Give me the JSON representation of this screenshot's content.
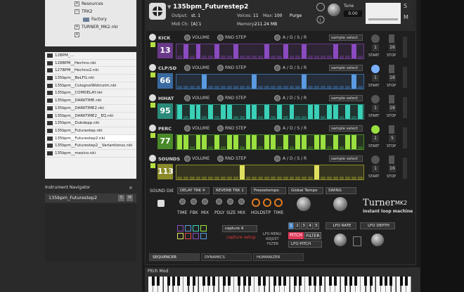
{
  "browser": {
    "tree": [
      {
        "label": "Resources",
        "type": "plus"
      },
      {
        "label": "TRK2",
        "type": "minus"
      },
      {
        "label": "Factory",
        "type": "folder"
      },
      {
        "label": "TURNER_MK2.nkr",
        "type": "plus"
      },
      {
        "label": "",
        "type": "plus"
      }
    ],
    "files": [
      "12BPM_...",
      "128BPM__Hechno.nki",
      "127BPM__Hechno2.nki",
      "135bpm__BeLFG.nki",
      "135bpm__ColognelWohnzim.nki",
      "135bpm__COMDELAY.nki",
      "135bpm__DARKTIME.nki",
      "135bpm__DARKTIME2.nki",
      "135bpm__DARKTIME2__EQ.nki",
      "135bpm__Dubdepp.nki",
      "135bpm__Futurestep.nki",
      "135bpm__Futurestep2.nki",
      "135bpm__Futurestep2__Variantionsc.nki",
      "135bpm__mexico.nki"
    ],
    "selected_index": 11
  },
  "navigator": {
    "title": "Instrument Navigator",
    "close": "×",
    "item": "135bpm_Futurestep2",
    "btn1": "S",
    "btn2": "M"
  },
  "header": {
    "title": "135bpm_Futurestep2",
    "output_label": "Output:",
    "output_value": "st. 1",
    "voices_label": "Voices:",
    "voices_value": "11",
    "max_label": "Max:",
    "max_value": "100",
    "purge_label": "Purge",
    "midi_label": "Midi Ch:",
    "midi_value": "[A]  1",
    "memory_label": "Memory:",
    "memory_value": "211.24 MB",
    "tune_label": "Tune",
    "tune_value": "0.00"
  },
  "common": {
    "volume": "VOLUME",
    "rnd_step": "RND STEP",
    "adsr": "A / D / S / R",
    "sample_select": "sample select",
    "start": "START",
    "stop": "STOP"
  },
  "tracks": [
    {
      "name": "KICK",
      "value": "13",
      "color": "#6a3a8a",
      "bar_color": "#8a4ac0",
      "bars": [
        0,
        1,
        0,
        1,
        0,
        0,
        1,
        0,
        0,
        1,
        0,
        0,
        0,
        0,
        1,
        0,
        0,
        1,
        0,
        0,
        1,
        0,
        0,
        0,
        0,
        1,
        0,
        0,
        1,
        0
      ],
      "start": "1",
      "stop": "16"
    },
    {
      "name": "CLP/SD",
      "value": "66",
      "color": "#3a6aa0",
      "bar_color": "#5a9ae0",
      "bars": [
        0,
        0,
        0,
        0,
        1,
        0,
        0,
        0,
        0,
        0,
        0,
        0,
        1,
        0,
        0,
        0,
        0,
        0,
        0,
        0,
        1,
        0,
        0,
        0,
        0,
        0,
        0,
        0,
        1,
        0
      ],
      "start": "1",
      "stop": "16"
    },
    {
      "name": "HIHAT",
      "value": "95",
      "color": "#2a8a7a",
      "bar_color": "#3ad0b8",
      "bars": [
        1,
        0,
        1,
        1,
        0,
        1,
        0,
        1,
        1,
        0,
        0,
        1,
        1,
        0,
        1,
        0,
        1,
        0,
        1,
        0,
        0,
        1,
        1,
        0,
        1,
        1,
        0,
        1,
        0,
        1
      ],
      "start": "1",
      "stop": "16"
    },
    {
      "name": "PERC",
      "value": "77",
      "color": "#4a8a2a",
      "bar_color": "#9ae040",
      "bars": [
        1,
        1,
        0,
        1,
        1,
        0,
        1,
        0,
        1,
        1,
        0,
        1,
        1,
        0,
        1,
        1,
        0,
        1,
        0,
        1,
        1,
        0,
        1,
        1,
        0,
        1,
        0,
        1,
        1,
        0
      ],
      "start": "1",
      "stop": "5"
    },
    {
      "name": "SOUNDS",
      "value": "113",
      "color": "#8a8a2a",
      "bar_color": "#e0e060",
      "bars": [
        0,
        0,
        0,
        0,
        0,
        0,
        0,
        0,
        0,
        0,
        1,
        0,
        0,
        0,
        0,
        0,
        0,
        0,
        0,
        0,
        0,
        0,
        1,
        0,
        0,
        0,
        0,
        0,
        0,
        0
      ],
      "start": "1",
      "stop": "16"
    }
  ],
  "fx": {
    "sound_die": "SOUND DIE",
    "delay_trk": "DELAY TRK 4",
    "reverb_trk": "REVERB TRK 1",
    "freeze": "Freezetempo",
    "global_temp": "Global Tempo",
    "swing": "SWING",
    "time": "TIME",
    "fbk": "FBK",
    "mix1": "MIX",
    "pdly": "PDLY",
    "size": "SIZE",
    "mix2": "MIX",
    "hold": "HOLD",
    "stp": "STP",
    "time2": "TIME",
    "turner": "Turner",
    "mk2": "MK2",
    "tagline": "instant loop machine",
    "capture_value": "capture 4",
    "capture_setup": "capture setup",
    "lfo_menu": "LFO MENU",
    "adjust": "ADJUST",
    "filter_lbl": "FILTER",
    "pitch": "PITCH",
    "filter": "FILTER",
    "lfo_pitch": "LFO PITCH",
    "lfo_rate": "LFO RATE",
    "lfo_depth": "LFO DEPTH",
    "num_buttons": [
      "1",
      "2",
      "3",
      "4",
      "5"
    ]
  },
  "tabs": [
    "SEQUENCER",
    "DYNAMICS",
    "HUMANIZER"
  ],
  "keyboard": {
    "label": "Pitch Mod"
  }
}
